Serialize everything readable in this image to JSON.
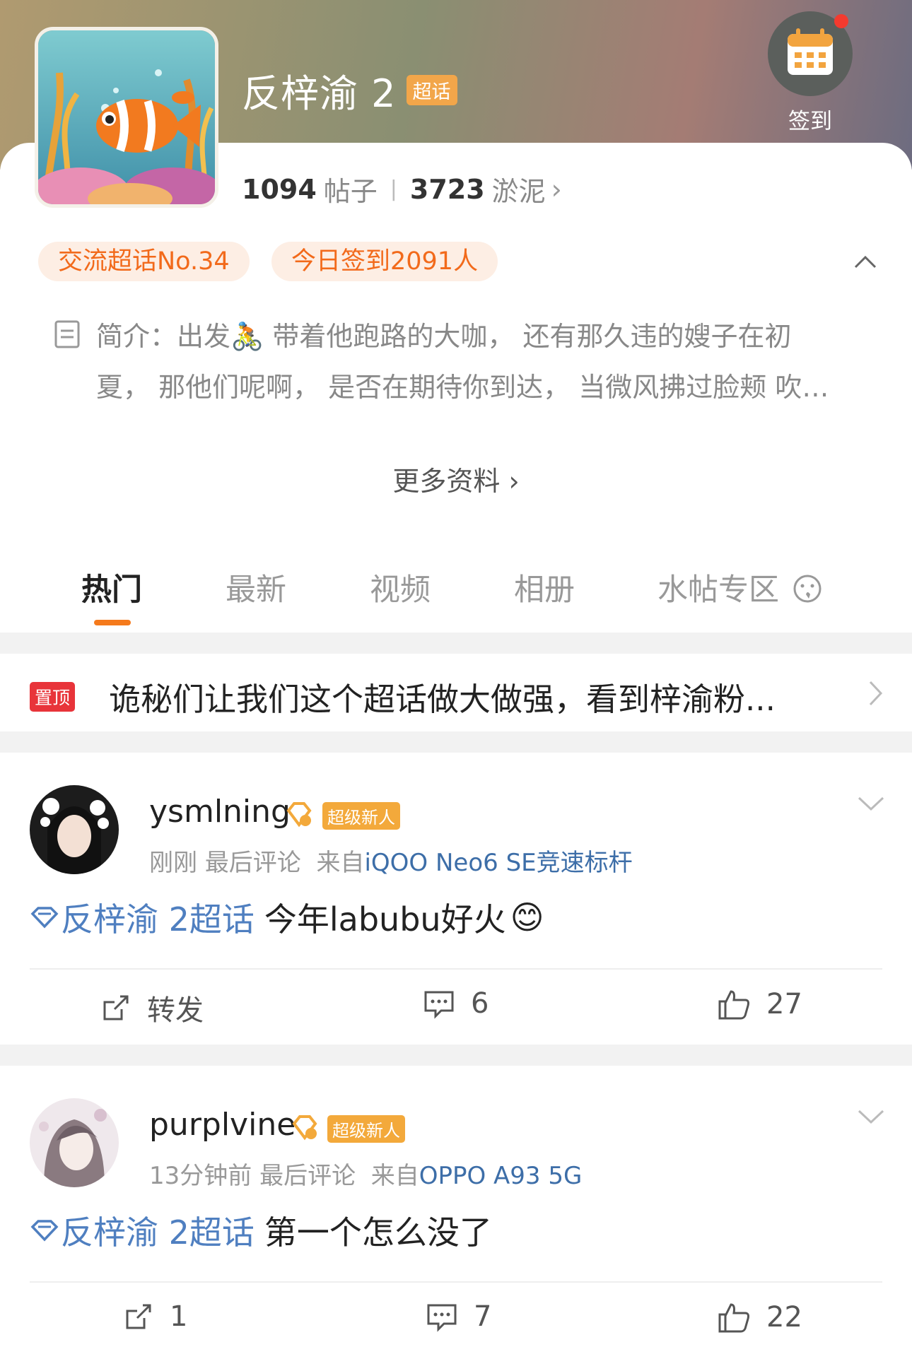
{
  "header": {
    "title": "反梓渝 2",
    "super_badge": "超话",
    "checkin_label": "签到",
    "posts_count": "1094",
    "posts_label": "帖子",
    "mud_count": "3723",
    "mud_label": "淤泥",
    "chevron": "›"
  },
  "pills": {
    "rank": "交流超话No.34",
    "today": "今日签到2091人"
  },
  "intro": {
    "line1": "简介：出发🚴 带着他跑路的大咖， 还有那久违的嫂子在初",
    "line2": "夏， 那他们呢啊， 是否在期待你到达， 当微风拂过脸颊 吹…",
    "more": "更多资料 ›"
  },
  "tabs": [
    "热门",
    "最新",
    "视频",
    "相册",
    "水帖专区"
  ],
  "pinned": {
    "badge": "置顶",
    "text": "诡秘们让我们这个超话做大做强，看到梓渝粉..."
  },
  "posts": [
    {
      "username": "ysmlning",
      "badge": "超级新人",
      "time": "刚刚",
      "action": "最后评论",
      "from": "来自",
      "device": "iQOO Neo6 SE竞速标杆",
      "topic": "反梓渝 2超话",
      "text": "今年labubu好火",
      "emoji": "😊",
      "repost": "转发",
      "comments": "6",
      "likes": "27"
    },
    {
      "username": "purplvine",
      "badge": "超级新人",
      "time": "13分钟前",
      "action": "最后评论",
      "from": "来自",
      "device": "OPPO A93 5G",
      "topic": "反梓渝 2超话",
      "text": "第一个怎么没了",
      "repost": "1",
      "comments": "7",
      "likes": "22"
    }
  ],
  "colors": {
    "accent": "#f57a1c",
    "topic_blue": "#4f7fc0",
    "pin_red": "#e8343a"
  }
}
